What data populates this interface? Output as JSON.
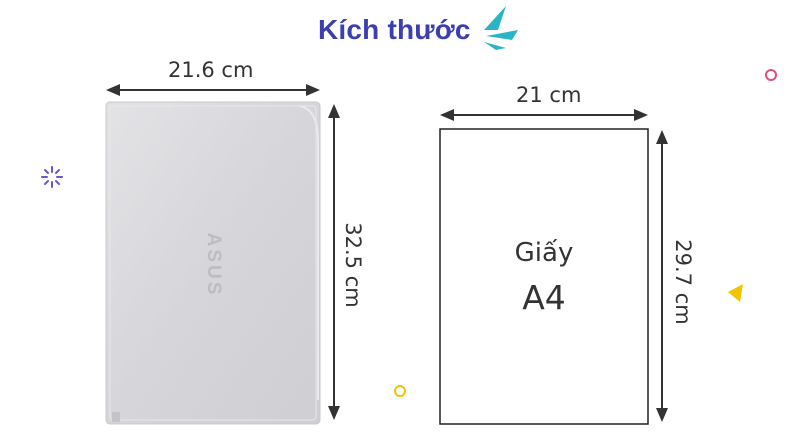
{
  "title": "Kích thước",
  "laptop": {
    "width_label": "21.6 cm",
    "height_label": "32.5 cm",
    "logo_text": "ASUS",
    "color": "#d9d9dc"
  },
  "paper": {
    "width_label": "21 cm",
    "height_label": "29.7 cm",
    "name": "Giấy",
    "size": "A4"
  },
  "colors": {
    "title": "#3b3fb0",
    "teal_accent": "#2bb4c6",
    "pink_circle": "#e84d7a",
    "yellow": "#f3c300",
    "sparkle": "#6a57c9"
  }
}
